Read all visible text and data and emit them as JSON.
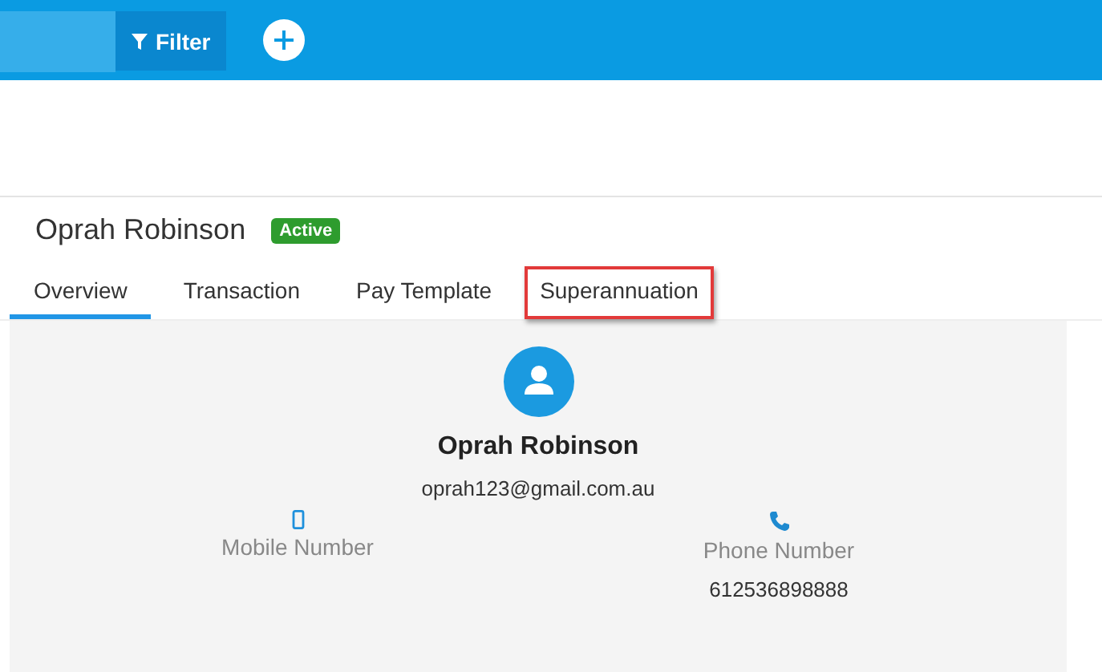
{
  "toolbar": {
    "filter_button": "Filter"
  },
  "employee": {
    "name": "Oprah Robinson",
    "status": "Active"
  },
  "tabs": [
    {
      "label": "Overview",
      "selected": true,
      "highlighted": false
    },
    {
      "label": "Transaction",
      "selected": false,
      "highlighted": false
    },
    {
      "label": "Pay Template",
      "selected": false,
      "highlighted": false
    },
    {
      "label": "Superannuation",
      "selected": false,
      "highlighted": true
    }
  ],
  "profile": {
    "name": "Oprah Robinson",
    "email": "oprah123@gmail.com.au",
    "contacts": [
      {
        "kind": "mobile",
        "label": "Mobile Number"
      },
      {
        "kind": "phone",
        "label": "Phone Number",
        "value": "612536898888"
      }
    ]
  }
}
